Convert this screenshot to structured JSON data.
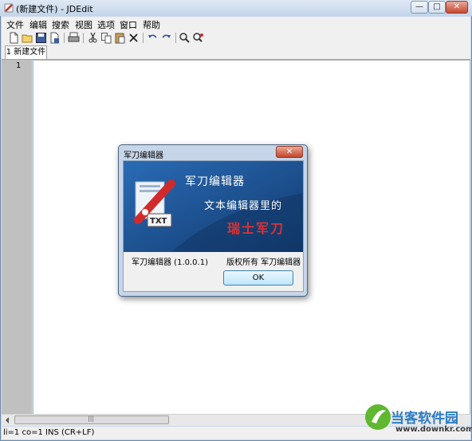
{
  "window": {
    "title": "(新建文件) - JDEdit"
  },
  "window_buttons": {
    "minimize": "—",
    "maximize": "□",
    "close": "✕"
  },
  "menu": [
    "文件",
    "编辑",
    "搜索",
    "视图",
    "选项",
    "窗口",
    "帮助"
  ],
  "toolbar": {
    "icons": [
      "new-file-icon",
      "open-folder-icon",
      "save-icon",
      "save-as-icon",
      "print-icon",
      "cut-icon",
      "copy-icon",
      "paste-icon",
      "delete-icon",
      "undo-icon",
      "redo-icon",
      "find-icon",
      "replace-icon"
    ]
  },
  "tab": {
    "label": "1 新建文件"
  },
  "editor": {
    "line_number": "1"
  },
  "scrollbar": {
    "thumb_grip": "|||"
  },
  "status": {
    "text": "li=1 co=1 INS (CR+LF)"
  },
  "dialog": {
    "title": "军刀编辑器",
    "close_label": "✕",
    "banner": {
      "line1": "军刀编辑器",
      "line2": "文本编辑器里的",
      "line3": "瑞士军刀",
      "badge": "TXT"
    },
    "app_name_version": "军刀编辑器 (1.0.0.1)",
    "copyright": "版权所有 军刀编辑器",
    "ok_label": "OK"
  },
  "watermark": {
    "name": "当客软件园",
    "url": "www.downkr.com"
  },
  "colors": {
    "banner_bg": "#1b4e8a",
    "accent_red": "#d12a2a",
    "title_bar": "#c9d8ea"
  }
}
